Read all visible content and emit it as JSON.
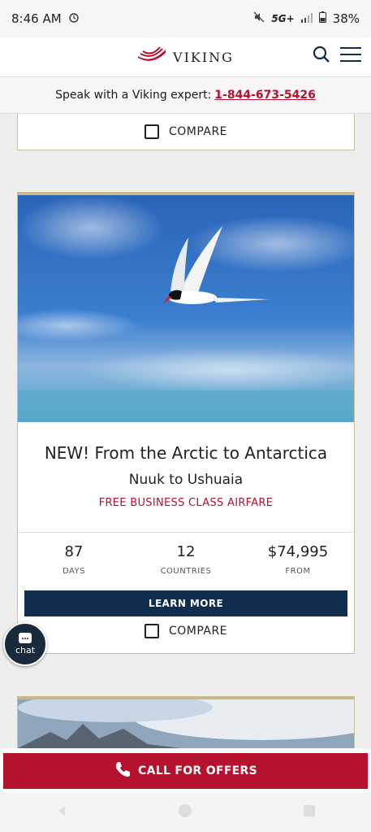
{
  "status_bar": {
    "time": "8:46 AM",
    "network": "5G+",
    "battery": "38%"
  },
  "header": {
    "brand": "VIKING"
  },
  "expert_bar": {
    "text": "Speak with a Viking expert:",
    "phone": "1-844-673-5426"
  },
  "prev_card": {
    "compare_label": "COMPARE"
  },
  "card": {
    "title": "NEW! From the Arctic to Antarctica",
    "route": "Nuuk to Ushuaia",
    "promo": "FREE BUSINESS CLASS AIRFARE",
    "stats": [
      {
        "value": "87",
        "label": "DAYS"
      },
      {
        "value": "12",
        "label": "COUNTRIES"
      },
      {
        "value": "$74,995",
        "label": "FROM"
      }
    ],
    "cta": "LEARN MORE",
    "compare_label": "COMPARE"
  },
  "chat": {
    "label": "chat"
  },
  "call_button": {
    "label": "CALL FOR OFFERS"
  },
  "colors": {
    "accent_red": "#b5122f",
    "navy": "#0f2d4f",
    "gold": "#c9b98a"
  }
}
